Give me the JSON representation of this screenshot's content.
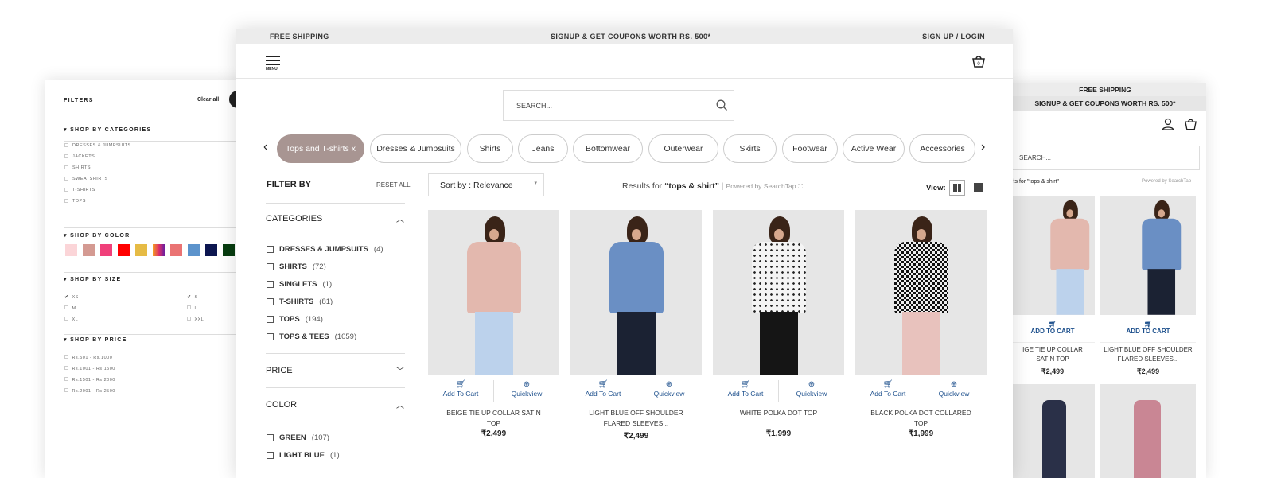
{
  "left_panel": {
    "title": "FILTERS",
    "clear_all": "Clear all",
    "categories_heading": "SHOP BY CATEGORIES",
    "categories": [
      "DRESSES & JUMPSUITS",
      "JACKETS",
      "SHIRTS",
      "SWEATSHIRTS",
      "T-SHIRTS",
      "TOPS"
    ],
    "color_heading": "SHOP BY COLOR",
    "colors": [
      "#fbd5d8",
      "#d49a92",
      "#f0407a",
      "#ff0000",
      "#e6bb45",
      "#f5a020",
      "#ea7373",
      "#5c93cc",
      "#0c1650",
      "#083d10"
    ],
    "size_heading": "SHOP BY SIZE",
    "sizes": [
      {
        "label": "XS",
        "checked": true
      },
      {
        "label": "S",
        "checked": true
      },
      {
        "label": "M",
        "checked": false
      },
      {
        "label": "L",
        "checked": false
      },
      {
        "label": "XL",
        "checked": false
      },
      {
        "label": "XXL",
        "checked": false
      }
    ],
    "price_heading": "SHOP BY PRICE",
    "prices": [
      "Rs.501 - Rs.1000",
      "Rs.1001 - Rs.1500",
      "Rs.1501 - Rs.2000",
      "Rs.2001 - Rs.2500"
    ]
  },
  "main": {
    "topbar": {
      "left": "FREE SHIPPING",
      "center": "SIGNUP & GET COUPONS WORTH RS. 500*",
      "right": "SIGN UP / LOGIN"
    },
    "menu_label": "MENU",
    "search_placeholder": "SEARCH...",
    "chips": [
      {
        "label": "Tops and T-shirts  x",
        "active": true
      },
      {
        "label": "Dresses & Jumpsuits"
      },
      {
        "label": "Shirts"
      },
      {
        "label": "Jeans"
      },
      {
        "label": "Bottomwear"
      },
      {
        "label": "Outerwear"
      },
      {
        "label": "Skirts"
      },
      {
        "label": "Footwear"
      },
      {
        "label": "Active Wear"
      },
      {
        "label": "Accessories"
      }
    ],
    "filter_by": "FILTER BY",
    "reset_all": "RESET ALL",
    "categories_heading": "CATEGORIES",
    "categories": [
      {
        "label": "DRESSES & JUMPSUITS",
        "count": "(4)"
      },
      {
        "label": "SHIRTS",
        "count": "(72)"
      },
      {
        "label": "SINGLETS",
        "count": "(1)"
      },
      {
        "label": "T-SHIRTS",
        "count": "(81)"
      },
      {
        "label": "TOPS",
        "count": "(194)"
      },
      {
        "label": "TOPS & TEES",
        "count": "(1059)"
      }
    ],
    "price_heading": "PRICE",
    "color_heading": "COLOR",
    "colors": [
      {
        "label": "GREEN",
        "count": "(107)"
      },
      {
        "label": "LIGHT BLUE",
        "count": "(1)"
      }
    ],
    "sort_label": "Sort by : Relevance",
    "results_prefix": "Results for ",
    "results_query": "“tops & shirt”",
    "powered_by": "Powered by SearchTap",
    "view_label": "View:",
    "add_to_cart": "Add To Cart",
    "quickview": "Quickview",
    "products": [
      {
        "name": "BEIGE TIE UP COLLAR SATIN TOP",
        "price": "₹2,499",
        "top": "#e3b8ae",
        "bottom": "#bcd2ec"
      },
      {
        "name": "LIGHT BLUE OFF SHOULDER FLARED SLEEVES...",
        "price": "₹2,499",
        "top": "#6a8fc4",
        "bottom": "#1b2233"
      },
      {
        "name": "WHITE POLKA DOT TOP",
        "price": "₹1,999",
        "top": "#f4f4f4",
        "bottom": "#151515"
      },
      {
        "name": "BLACK POLKA DOT COLLARED TOP",
        "price": "₹1,999",
        "top": "#555555",
        "bottom": "#e8c2bd"
      }
    ]
  },
  "right_panel": {
    "line1": "FREE SHIPPING",
    "line2": "SIGNUP & GET COUPONS WORTH RS. 500*",
    "search_placeholder": "SEARCH...",
    "results": "lts for \"tops & shirt\"",
    "powered_by": "Powered by SearchTap",
    "add_to_cart": "ADD TO CART",
    "products": [
      {
        "name": "IGE TIE UP COLLAR SATIN TOP",
        "price": "₹2,499"
      },
      {
        "name": "LIGHT BLUE OFF SHOULDER FLARED SLEEVES...",
        "price": "₹2,499"
      }
    ]
  }
}
